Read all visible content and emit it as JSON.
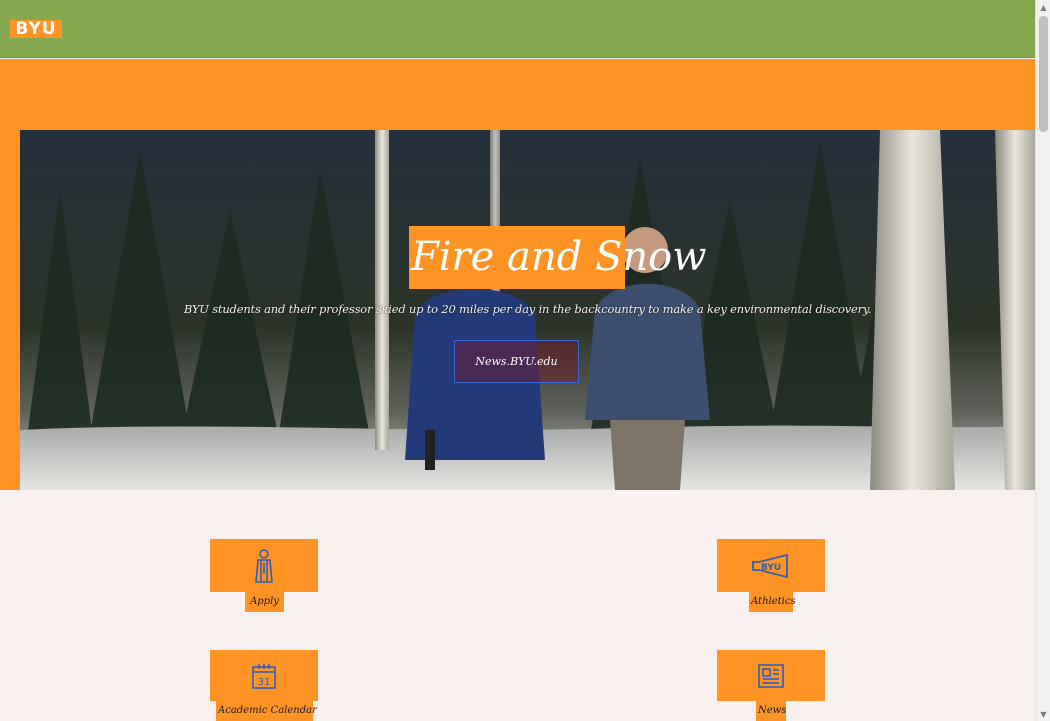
{
  "header": {
    "logo_text": "BYU"
  },
  "hero": {
    "title": "Fire and Snow",
    "subtitle": "BYU students and their professor skied up to 20 miles per day in the backcountry to make a key environmental discovery.",
    "button_label": "News.BYU.edu"
  },
  "tiles": [
    {
      "label": "Apply",
      "icon": "graduate-figure-icon"
    },
    {
      "label": "Athletics",
      "icon": "byu-megaphone-icon"
    },
    {
      "label": "Academic Calendar",
      "icon": "calendar-icon",
      "icon_text": "31"
    },
    {
      "label": "News",
      "icon": "newspaper-icon"
    }
  ],
  "colors": {
    "header_green": "#84a951",
    "accent_orange": "#ff9324",
    "page_background": "#f9f0f0",
    "icon_blue": "#2f5fb7",
    "button_border": "#3466d6"
  }
}
